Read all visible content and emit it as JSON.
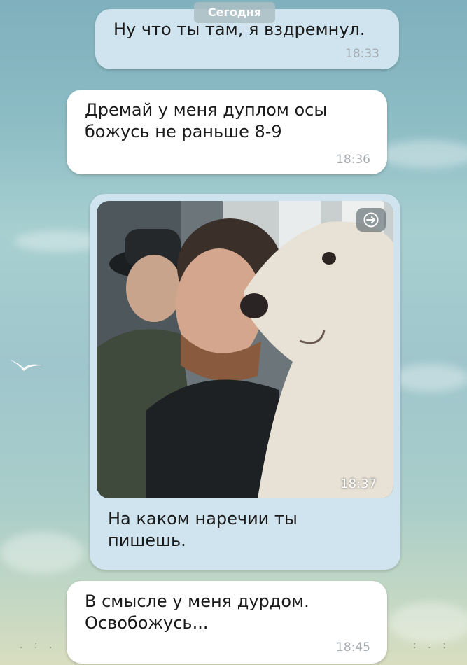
{
  "date_divider": "Сегодня",
  "messages": [
    {
      "text": "Ну что ты там, я вздремнул.",
      "time": "18:33"
    },
    {
      "text": "Дремай у меня дуплом осы\nбожусь не раньше 8-9",
      "time": "18:36"
    },
    {
      "photo_time": "18:37",
      "text": "На каком наречии ты\nпишешь."
    },
    {
      "text": "В смысле у меня дурдом.\nОсвобожусь...",
      "time": "18:45"
    }
  ],
  "icons": {
    "photo_share": "share-arrow-icon",
    "wallpaper_bird": "bird-icon"
  },
  "colors": {
    "outgoing_bubble": "#cfe4ee",
    "incoming_bubble": "#ffffff",
    "timestamp": "#a5abb0"
  }
}
